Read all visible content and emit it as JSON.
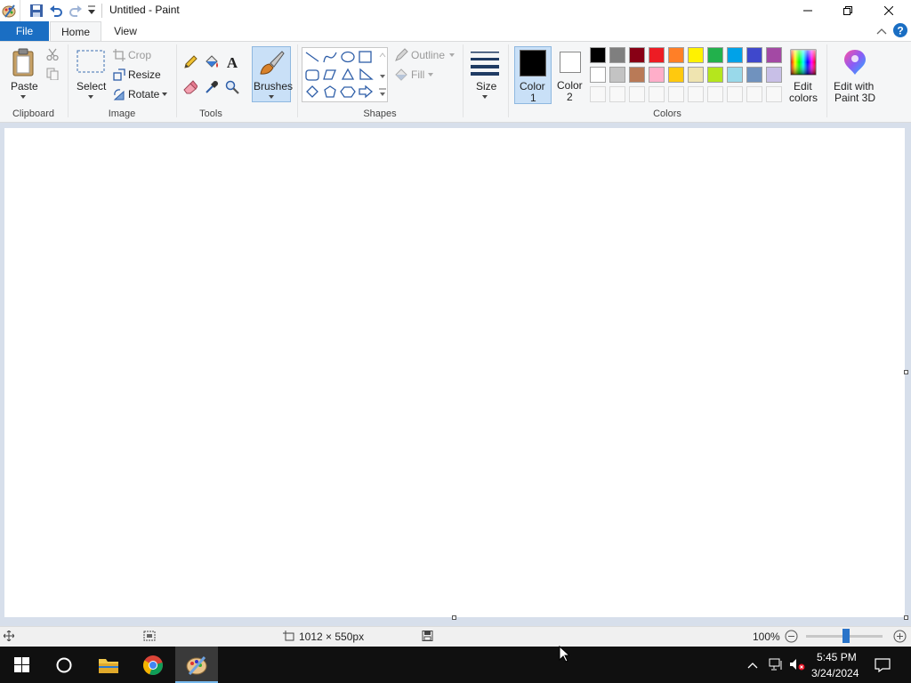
{
  "window": {
    "title": "Untitled - Paint"
  },
  "tabs": {
    "file": "File",
    "home": "Home",
    "view": "View"
  },
  "clipboard": {
    "paste": "Paste",
    "group": "Clipboard"
  },
  "image": {
    "select": "Select",
    "crop": "Crop",
    "resize": "Resize",
    "rotate": "Rotate",
    "group": "Image"
  },
  "tools": {
    "group": "Tools"
  },
  "brushes": {
    "label": "Brushes"
  },
  "shapes": {
    "outline": "Outline",
    "fill": "Fill",
    "group": "Shapes"
  },
  "size": {
    "label": "Size"
  },
  "colors": {
    "color1_a": "Color",
    "color1_b": "1",
    "color2_a": "Color",
    "color2_b": "2",
    "edit_a": "Edit",
    "edit_b": "colors",
    "paint3d_a": "Edit with",
    "paint3d_b": "Paint 3D",
    "group": "Colors",
    "color1": "#000000",
    "color2": "#ffffff",
    "palette_row1": [
      "#000000",
      "#7f7f7f",
      "#880015",
      "#ed1c24",
      "#ff7f27",
      "#fff200",
      "#22b14c",
      "#00a2e8",
      "#3f48cc",
      "#a349a4"
    ],
    "palette_row2": [
      "#ffffff",
      "#c3c3c3",
      "#b97a57",
      "#ffaec9",
      "#ffc90e",
      "#efe4b0",
      "#b5e61d",
      "#99d9ea",
      "#7092be",
      "#c8bfe7"
    ]
  },
  "status": {
    "dimensions": "1012 × 550px",
    "zoom": "100%"
  },
  "taskbar": {
    "time": "5:45 PM",
    "date": "3/24/2024"
  }
}
